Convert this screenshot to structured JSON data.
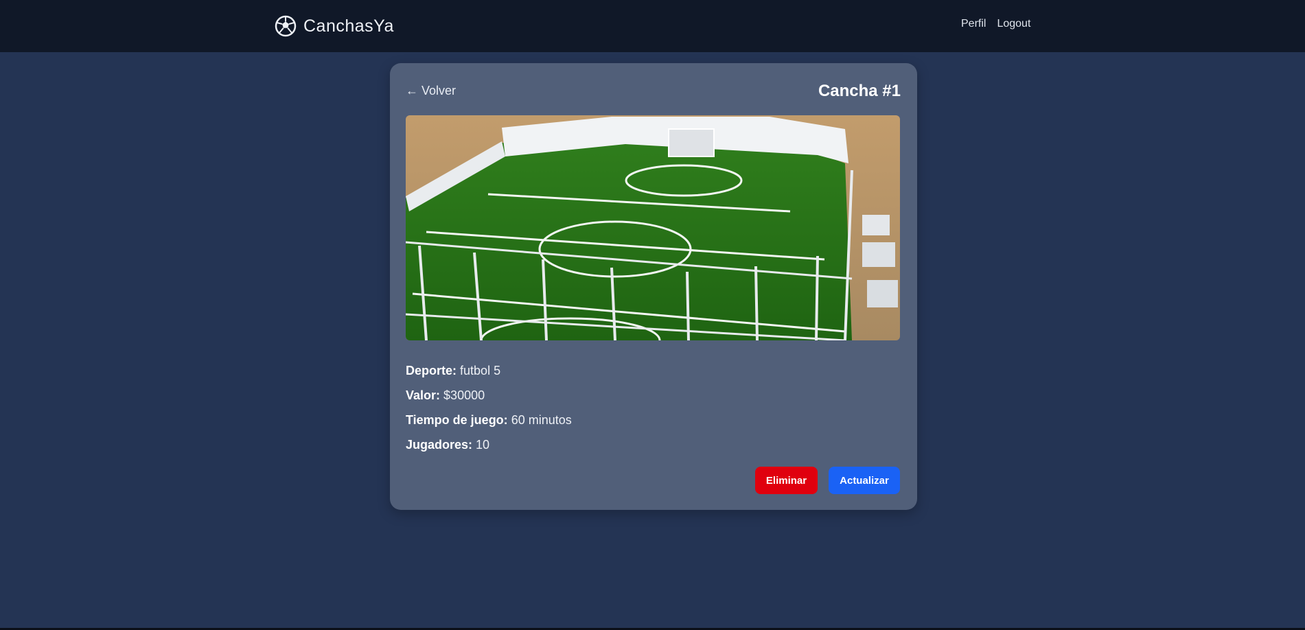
{
  "nav": {
    "brand": "CanchasYa",
    "brand_icon": "soccer-ball-icon",
    "links": {
      "profile": "Perfil",
      "logout": "Logout"
    }
  },
  "court": {
    "back_label": "← Volver",
    "title": "Cancha #1",
    "photo": "court-photo",
    "details": {
      "sport_label": "Deporte:",
      "sport_value": "futbol 5",
      "price_label": "Valor:",
      "price_value": "$30000",
      "time_label": "Tiempo de juego:",
      "time_value": "60 minutos",
      "players_label": "Jugadores:",
      "players_value": "10"
    },
    "actions": {
      "delete": "Eliminar",
      "update": "Actualizar"
    }
  },
  "colors": {
    "navbar": "#101828",
    "background": "#243454",
    "card": "#515f79",
    "delete": "#e0000e",
    "update": "#1a62f5"
  }
}
